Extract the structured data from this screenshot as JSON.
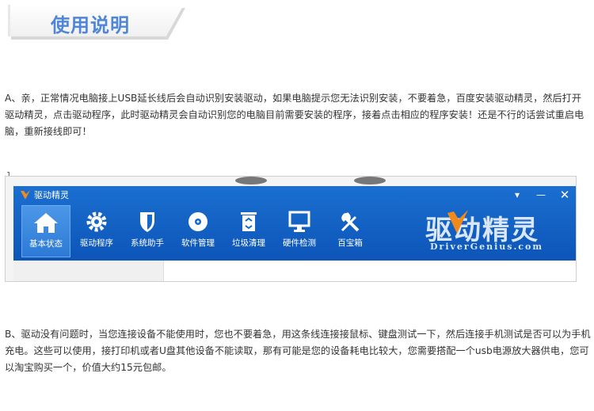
{
  "header": {
    "title": "使用说明"
  },
  "paragraphs": {
    "a": "A、亲，正常情况电脑接上USB延长线后会自动识别安装驱动，如果电脑提示您无法识别安装，不要着急，百度安装驱动精灵，然后打开驱动精灵，点击驱动程序，此时驱动精灵会自动识别您的电脑目前需要安装的程序，接着点击相应的程序安装！还是不行的话尝试重启电脑，重新接线即可！",
    "b": "B、驱动没有问题时，当您连接设备不能使用时，您也不要着急，用这条线连接接鼠标、键盘测试一下，然后连接手机测试是否可以为手机充电。这些可以使用，接打印机或者U盘其他设备不能读取，那有可能是您的设备耗电比较大，您需要搭配一个usb电源放大器供电，您可以淘宝购买一个，价值大约15元包邮。"
  },
  "small_mark": "1、",
  "app": {
    "title": "驱动精灵",
    "window_controls": {
      "menu": "▾",
      "minimize": "—",
      "close": "✕"
    },
    "toolbar": [
      {
        "label": "基本状态",
        "icon": "home-icon",
        "active": true
      },
      {
        "label": "驱动程序",
        "icon": "gear-icon",
        "active": false
      },
      {
        "label": "系统助手",
        "icon": "shield-icon",
        "active": false
      },
      {
        "label": "软件管理",
        "icon": "disc-icon",
        "active": false
      },
      {
        "label": "垃圾清理",
        "icon": "trash-icon",
        "active": false
      },
      {
        "label": "硬件检测",
        "icon": "monitor-icon",
        "active": false
      },
      {
        "label": "百宝箱",
        "icon": "tools-icon",
        "active": false
      }
    ],
    "brand": {
      "cn": "驱动精灵",
      "en": "DriverGenius.com"
    }
  },
  "colors": {
    "header_title": "#4f87d6",
    "app_blue": "#1567c8",
    "logo_orange": "#f08a1c"
  }
}
